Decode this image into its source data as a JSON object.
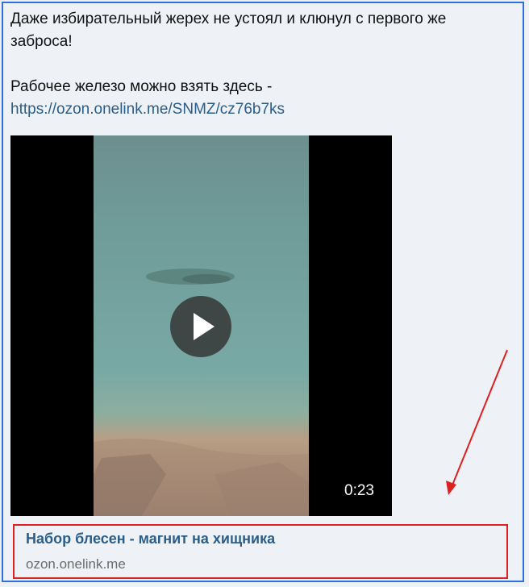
{
  "post": {
    "line1": "Даже избирательный жерех не устоял и клюнул с первого же",
    "line2": "заброса!",
    "line3": "Рабочее железо можно взять здесь -",
    "link": "https://ozon.onelink.me/SNMZ/cz76b7ks"
  },
  "video": {
    "duration": "0:23",
    "play_icon": "play-icon"
  },
  "link_preview": {
    "title": "Набор блесен - магнит на хищника",
    "domain": "ozon.onelink.me"
  },
  "colors": {
    "frame_border": "#2f6fe0",
    "annotation_red": "#e02020",
    "link_blue": "#2a5d8a"
  }
}
